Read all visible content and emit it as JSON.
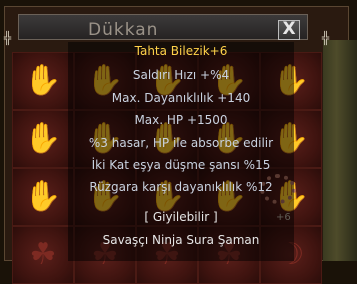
{
  "window": {
    "title": "Dükkan",
    "close_label": "X"
  },
  "tooltip": {
    "item_name": "Tahta Bilezik+6",
    "stats": [
      "Saldırı Hızı +%4",
      "Max. Dayanıklılık +140",
      "Max. HP +1500",
      "%3 hasar, HP ile absorbe edilir",
      "İki Kat eşya düşme şansı %15",
      "Rüzgara karşı dayanıklılık %12"
    ],
    "wearable": "[ Giyilebilir ]",
    "classes": "Savaşçı Ninja Sura Şaman"
  },
  "ring_item": {
    "count": "+6"
  },
  "colors": {
    "item_name": "#ffd24a",
    "stat": "#c9d2e0",
    "neutral": "#e6e6e6",
    "slot": "#5a1f1a"
  }
}
